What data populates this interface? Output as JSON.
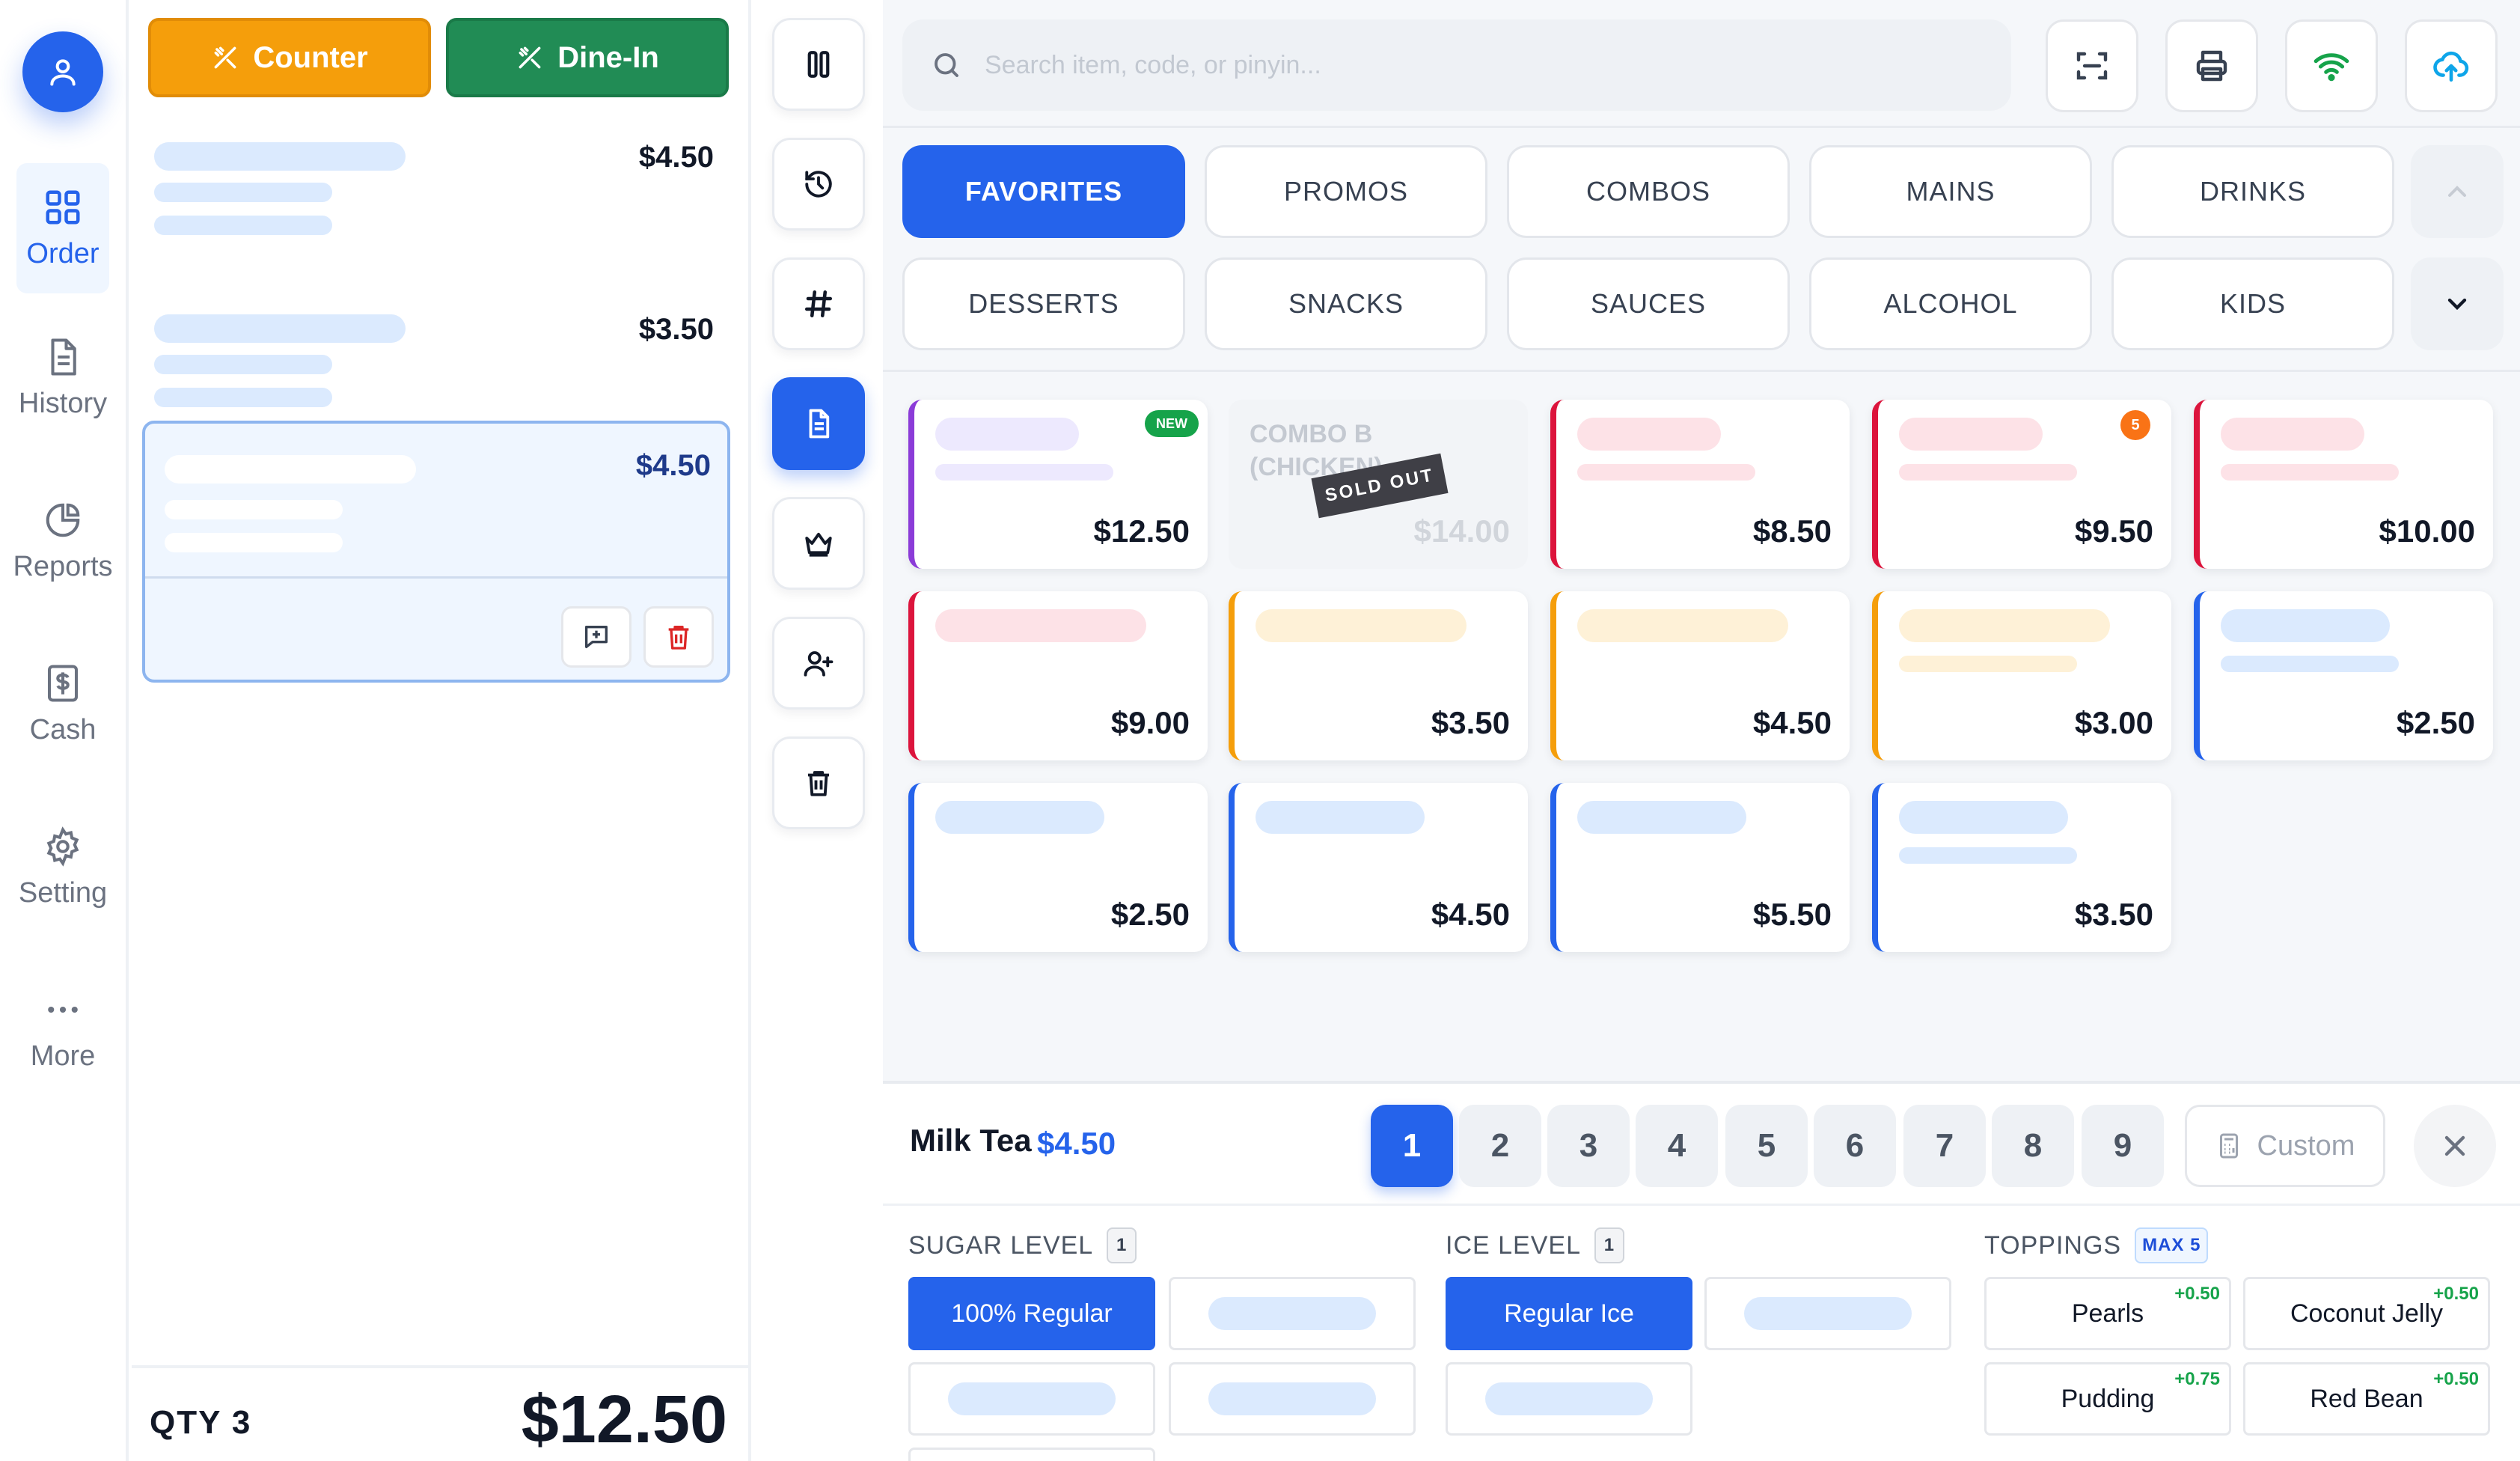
{
  "nav": {
    "items": [
      {
        "label": "Order",
        "icon": "grid-icon"
      },
      {
        "label": "History",
        "icon": "document-icon"
      },
      {
        "label": "Reports",
        "icon": "pie-chart-icon"
      },
      {
        "label": "Cash",
        "icon": "dollar-icon"
      },
      {
        "label": "Setting",
        "icon": "gear-icon"
      },
      {
        "label": "More",
        "icon": "dots-icon"
      }
    ]
  },
  "order": {
    "counter_label": "Counter",
    "dinein_label": "Dine-In",
    "lines": [
      {
        "price": "$4.50"
      },
      {
        "price": "$3.50"
      },
      {
        "price": "$4.50"
      }
    ],
    "qty_label": "QTY 3",
    "total": "$12.50"
  },
  "search": {
    "placeholder": "Search item, code, or pinyin..."
  },
  "categories": {
    "row1": [
      "FAVORITES",
      "PROMOS",
      "COMBOS",
      "MAINS",
      "DRINKS"
    ],
    "row2": [
      "DESSERTS",
      "SNACKS",
      "SAUCES",
      "ALCOHOL",
      "KIDS"
    ],
    "active": "FAVORITES"
  },
  "products": [
    {
      "price": "$12.50",
      "badge": "NEW",
      "color": "#8b3bd8"
    },
    {
      "name": "COMBO B (CHICKEN)",
      "price": "$14.00",
      "status": "SOLD OUT"
    },
    {
      "price": "$8.50",
      "color": "#dc143c"
    },
    {
      "price": "$9.50",
      "badge": "5",
      "color": "#dc143c"
    },
    {
      "price": "$10.00",
      "color": "#dc143c"
    },
    {
      "price": "$9.00",
      "color": "#dc143c"
    },
    {
      "price": "$3.50",
      "color": "#f59e0b"
    },
    {
      "price": "$4.50",
      "color": "#f59e0b"
    },
    {
      "price": "$3.00",
      "color": "#f59e0b"
    },
    {
      "price": "$2.50",
      "color": "#2563eb"
    },
    {
      "price": "$2.50",
      "color": "#2563eb"
    },
    {
      "price": "$4.50",
      "color": "#2563eb"
    },
    {
      "price": "$5.50",
      "color": "#2563eb"
    },
    {
      "price": "$3.50",
      "color": "#2563eb"
    }
  ],
  "customize": {
    "item_name": "Milk Tea",
    "item_price": "$4.50",
    "quantities": [
      "1",
      "2",
      "3",
      "4",
      "5",
      "6",
      "7",
      "8",
      "9"
    ],
    "selected_quantity": "1",
    "custom_label": "Custom",
    "sugar": {
      "title": "SUGAR LEVEL",
      "badge": "1",
      "selected": "100% Regular"
    },
    "ice": {
      "title": "ICE LEVEL",
      "badge": "1",
      "selected": "Regular Ice"
    },
    "toppings": {
      "title": "TOPPINGS",
      "badge": "MAX 5",
      "items": [
        {
          "name": "Pearls",
          "extra": "+0.50"
        },
        {
          "name": "Coconut Jelly",
          "extra": "+0.50"
        },
        {
          "name": "Pudding",
          "extra": "+0.75"
        },
        {
          "name": "Red Bean",
          "extra": "+0.50"
        }
      ]
    }
  },
  "colors": {
    "accent": "#2563eb",
    "counter": "#f59e0b",
    "dinein": "#218c55",
    "danger": "#dc2626",
    "success": "#16a34a"
  }
}
